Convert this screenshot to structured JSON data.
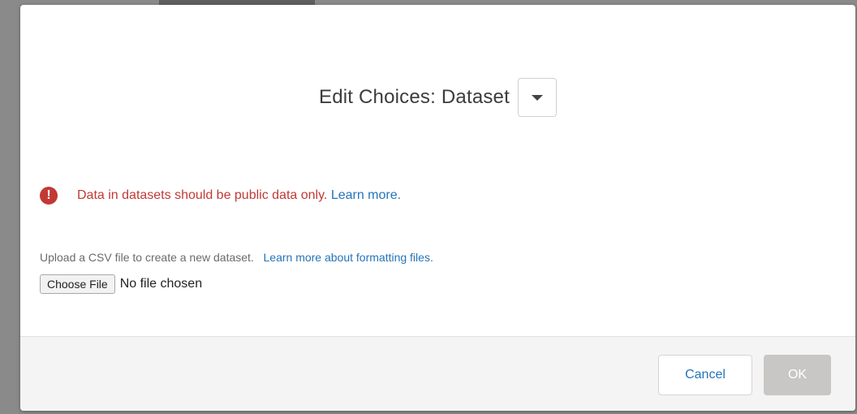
{
  "dialog": {
    "title": "Edit Choices: Dataset",
    "dropdown_icon": "caret-down-icon"
  },
  "warning": {
    "icon": "exclamation-circle-icon",
    "text": "Data in datasets should be public data only.",
    "link": "Learn more.",
    "color": "#c23934"
  },
  "upload": {
    "description": "Upload a CSV file to create a new dataset.",
    "link": "Learn more about formatting files.",
    "choose_label": "Choose File",
    "status": "No file chosen"
  },
  "footer": {
    "cancel_label": "Cancel",
    "ok_label": "OK"
  },
  "colors": {
    "link": "#2574b9",
    "ok_disabled": "#c9c7c5"
  }
}
